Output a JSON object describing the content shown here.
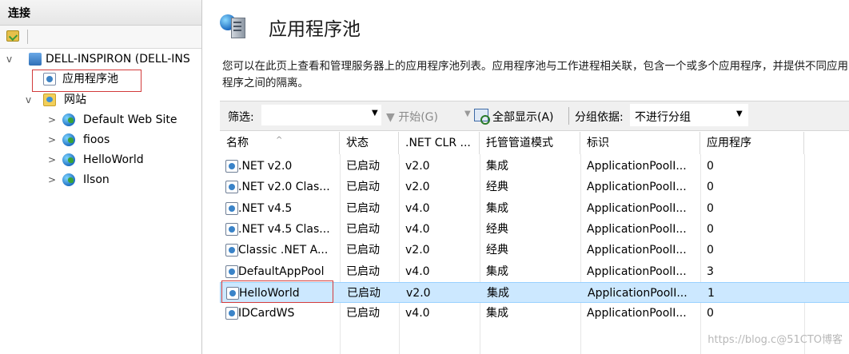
{
  "connections": {
    "header": "连接",
    "tree": {
      "server": "DELL-INSPIRON (DELL-INS",
      "app_pools": "应用程序池",
      "sites": "网站",
      "site_items": [
        "Default Web Site",
        "fioos",
        "HelloWorld",
        "Ilson"
      ]
    }
  },
  "main": {
    "title": "应用程序池",
    "description": "您可以在此页上查看和管理服务器上的应用程序池列表。应用程序池与工作进程相关联，包含一个或多个应用程序，并提供不同应用程序之间的隔离。",
    "filter_bar": {
      "filter_label": "筛选:",
      "filter_value": "",
      "start_label": "开始(G)",
      "showall_label": "全部显示(A)",
      "group_label": "分组依据:",
      "group_value": "不进行分组"
    },
    "table": {
      "columns": [
        "名称",
        "状态",
        ".NET CLR ...",
        "托管管道模式",
        "标识",
        "应用程序"
      ],
      "rows": [
        [
          ".NET v2.0",
          "已启动",
          "v2.0",
          "集成",
          "ApplicationPoolI...",
          "0"
        ],
        [
          ".NET v2.0 Clas...",
          "已启动",
          "v2.0",
          "经典",
          "ApplicationPoolI...",
          "0"
        ],
        [
          ".NET v4.5",
          "已启动",
          "v4.0",
          "集成",
          "ApplicationPoolI...",
          "0"
        ],
        [
          ".NET v4.5 Clas...",
          "已启动",
          "v4.0",
          "经典",
          "ApplicationPoolI...",
          "0"
        ],
        [
          "Classic .NET A...",
          "已启动",
          "v2.0",
          "经典",
          "ApplicationPoolI...",
          "0"
        ],
        [
          "DefaultAppPool",
          "已启动",
          "v4.0",
          "集成",
          "ApplicationPoolI...",
          "3"
        ],
        [
          "HelloWorld",
          "已启动",
          "v2.0",
          "集成",
          "ApplicationPoolI...",
          "1"
        ],
        [
          "IDCardWS",
          "已启动",
          "v4.0",
          "集成",
          "ApplicationPoolI...",
          "0"
        ]
      ],
      "selected_row": 6
    }
  },
  "watermark": "https://blog.c@51CTO博客",
  "colors": {
    "selection": "#cce8ff",
    "highlight_box": "#d23b3b",
    "panel_bg": "#f0f0f0"
  }
}
